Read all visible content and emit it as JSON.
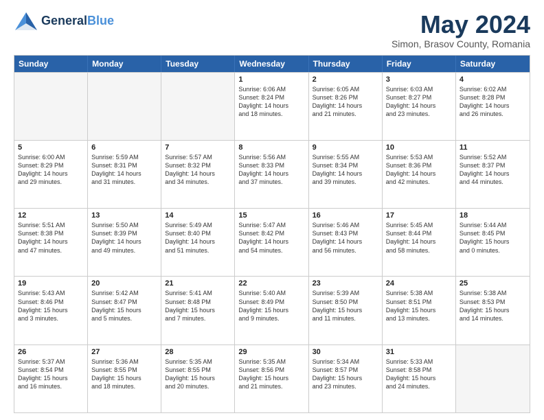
{
  "header": {
    "logo_line1": "General",
    "logo_line2": "Blue",
    "title": "May 2024",
    "subtitle": "Simon, Brasov County, Romania"
  },
  "weekdays": [
    "Sunday",
    "Monday",
    "Tuesday",
    "Wednesday",
    "Thursday",
    "Friday",
    "Saturday"
  ],
  "weeks": [
    [
      {
        "day": "",
        "info": ""
      },
      {
        "day": "",
        "info": ""
      },
      {
        "day": "",
        "info": ""
      },
      {
        "day": "1",
        "info": "Sunrise: 6:06 AM\nSunset: 8:24 PM\nDaylight: 14 hours\nand 18 minutes."
      },
      {
        "day": "2",
        "info": "Sunrise: 6:05 AM\nSunset: 8:26 PM\nDaylight: 14 hours\nand 21 minutes."
      },
      {
        "day": "3",
        "info": "Sunrise: 6:03 AM\nSunset: 8:27 PM\nDaylight: 14 hours\nand 23 minutes."
      },
      {
        "day": "4",
        "info": "Sunrise: 6:02 AM\nSunset: 8:28 PM\nDaylight: 14 hours\nand 26 minutes."
      }
    ],
    [
      {
        "day": "5",
        "info": "Sunrise: 6:00 AM\nSunset: 8:29 PM\nDaylight: 14 hours\nand 29 minutes."
      },
      {
        "day": "6",
        "info": "Sunrise: 5:59 AM\nSunset: 8:31 PM\nDaylight: 14 hours\nand 31 minutes."
      },
      {
        "day": "7",
        "info": "Sunrise: 5:57 AM\nSunset: 8:32 PM\nDaylight: 14 hours\nand 34 minutes."
      },
      {
        "day": "8",
        "info": "Sunrise: 5:56 AM\nSunset: 8:33 PM\nDaylight: 14 hours\nand 37 minutes."
      },
      {
        "day": "9",
        "info": "Sunrise: 5:55 AM\nSunset: 8:34 PM\nDaylight: 14 hours\nand 39 minutes."
      },
      {
        "day": "10",
        "info": "Sunrise: 5:53 AM\nSunset: 8:36 PM\nDaylight: 14 hours\nand 42 minutes."
      },
      {
        "day": "11",
        "info": "Sunrise: 5:52 AM\nSunset: 8:37 PM\nDaylight: 14 hours\nand 44 minutes."
      }
    ],
    [
      {
        "day": "12",
        "info": "Sunrise: 5:51 AM\nSunset: 8:38 PM\nDaylight: 14 hours\nand 47 minutes."
      },
      {
        "day": "13",
        "info": "Sunrise: 5:50 AM\nSunset: 8:39 PM\nDaylight: 14 hours\nand 49 minutes."
      },
      {
        "day": "14",
        "info": "Sunrise: 5:49 AM\nSunset: 8:40 PM\nDaylight: 14 hours\nand 51 minutes."
      },
      {
        "day": "15",
        "info": "Sunrise: 5:47 AM\nSunset: 8:42 PM\nDaylight: 14 hours\nand 54 minutes."
      },
      {
        "day": "16",
        "info": "Sunrise: 5:46 AM\nSunset: 8:43 PM\nDaylight: 14 hours\nand 56 minutes."
      },
      {
        "day": "17",
        "info": "Sunrise: 5:45 AM\nSunset: 8:44 PM\nDaylight: 14 hours\nand 58 minutes."
      },
      {
        "day": "18",
        "info": "Sunrise: 5:44 AM\nSunset: 8:45 PM\nDaylight: 15 hours\nand 0 minutes."
      }
    ],
    [
      {
        "day": "19",
        "info": "Sunrise: 5:43 AM\nSunset: 8:46 PM\nDaylight: 15 hours\nand 3 minutes."
      },
      {
        "day": "20",
        "info": "Sunrise: 5:42 AM\nSunset: 8:47 PM\nDaylight: 15 hours\nand 5 minutes."
      },
      {
        "day": "21",
        "info": "Sunrise: 5:41 AM\nSunset: 8:48 PM\nDaylight: 15 hours\nand 7 minutes."
      },
      {
        "day": "22",
        "info": "Sunrise: 5:40 AM\nSunset: 8:49 PM\nDaylight: 15 hours\nand 9 minutes."
      },
      {
        "day": "23",
        "info": "Sunrise: 5:39 AM\nSunset: 8:50 PM\nDaylight: 15 hours\nand 11 minutes."
      },
      {
        "day": "24",
        "info": "Sunrise: 5:38 AM\nSunset: 8:51 PM\nDaylight: 15 hours\nand 13 minutes."
      },
      {
        "day": "25",
        "info": "Sunrise: 5:38 AM\nSunset: 8:53 PM\nDaylight: 15 hours\nand 14 minutes."
      }
    ],
    [
      {
        "day": "26",
        "info": "Sunrise: 5:37 AM\nSunset: 8:54 PM\nDaylight: 15 hours\nand 16 minutes."
      },
      {
        "day": "27",
        "info": "Sunrise: 5:36 AM\nSunset: 8:55 PM\nDaylight: 15 hours\nand 18 minutes."
      },
      {
        "day": "28",
        "info": "Sunrise: 5:35 AM\nSunset: 8:55 PM\nDaylight: 15 hours\nand 20 minutes."
      },
      {
        "day": "29",
        "info": "Sunrise: 5:35 AM\nSunset: 8:56 PM\nDaylight: 15 hours\nand 21 minutes."
      },
      {
        "day": "30",
        "info": "Sunrise: 5:34 AM\nSunset: 8:57 PM\nDaylight: 15 hours\nand 23 minutes."
      },
      {
        "day": "31",
        "info": "Sunrise: 5:33 AM\nSunset: 8:58 PM\nDaylight: 15 hours\nand 24 minutes."
      },
      {
        "day": "",
        "info": ""
      }
    ]
  ]
}
